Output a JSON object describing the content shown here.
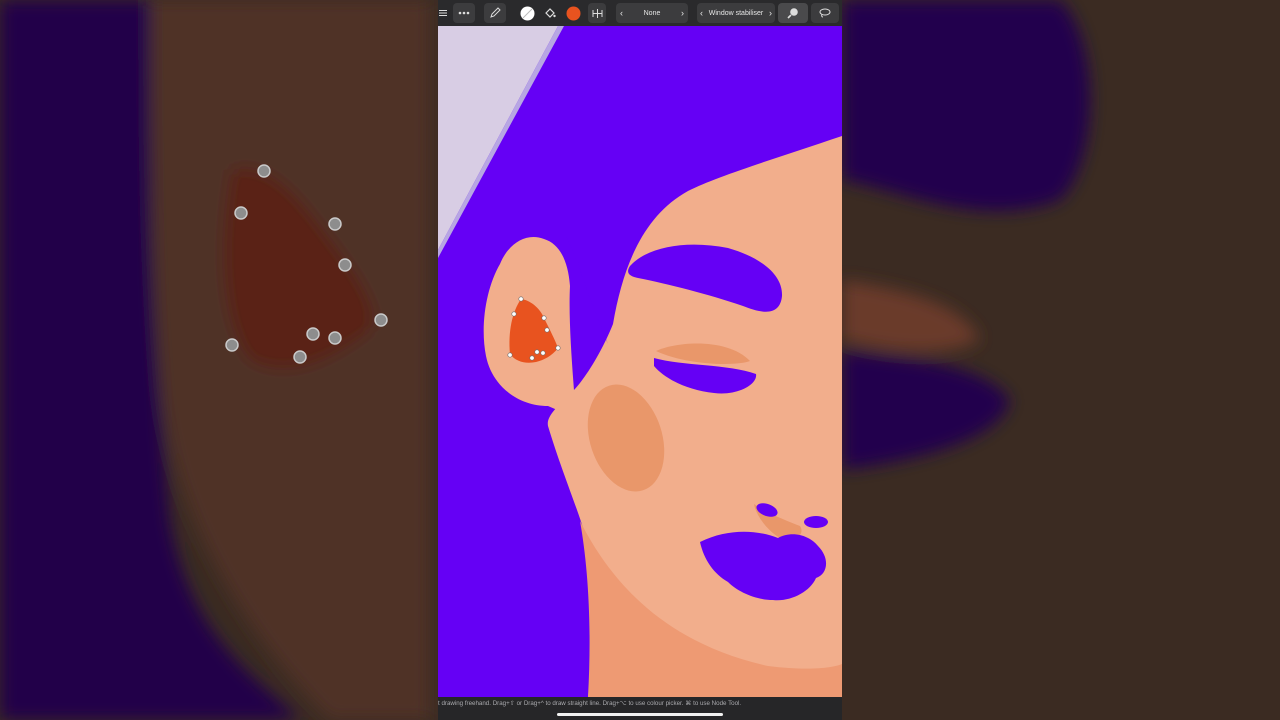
{
  "app": {
    "toolbar": {
      "menu_icon": "hamburger-menu-icon",
      "more_icon": "ellipsis-icon",
      "pencil_icon": "pencil-tool-icon",
      "colour_primary": "#ffffff",
      "fill_icon": "paint-fill-icon",
      "colour_secondary": "#e8531f",
      "snapping_icon": "snapping-icon",
      "blend_mode": {
        "value": "None"
      },
      "stabiliser": {
        "value": "Window stabiliser"
      },
      "search_icon": "search-zoom-icon",
      "lasso_icon": "lasso-icon"
    },
    "status_hint": "t drawing freehand. Drag+⇧ or Drag+^ to draw straight line. Drag+⌥ to use colour picker. ⌘ to use Node Tool."
  },
  "colors": {
    "hair": "#6500f5",
    "skin": "#f2ae8c",
    "shadow": "#ee9a73",
    "blush": "#e9976a",
    "ear_fill": "#e8531f",
    "background_light": "#d8cde4",
    "blurred_backdrop": "#3a2a22"
  }
}
